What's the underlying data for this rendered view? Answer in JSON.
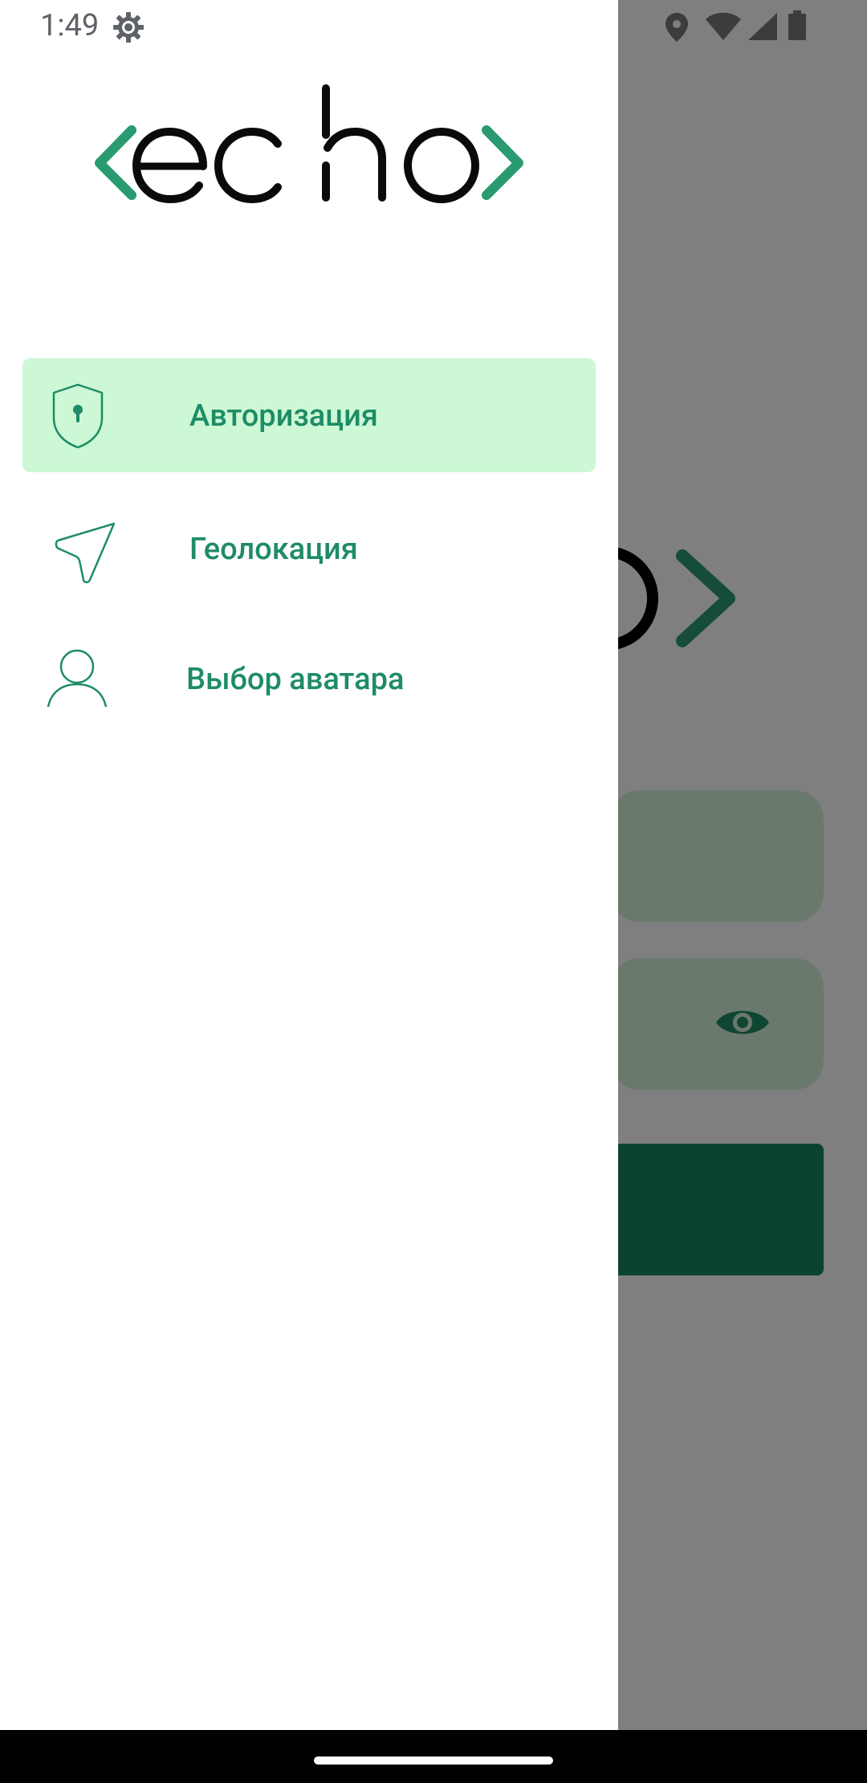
{
  "status_bar": {
    "time": "1:49",
    "icons": [
      "gear-icon",
      "location-icon",
      "wifi-icon",
      "signal-icon",
      "battery-icon"
    ]
  },
  "drawer": {
    "logo_text": "echo",
    "menu": [
      {
        "label": "Авторизация",
        "icon": "shield-lock-icon",
        "active": true
      },
      {
        "label": "Геолокация",
        "icon": "navigation-arrow-icon",
        "active": false
      },
      {
        "label": "Выбор аватара",
        "icon": "person-icon",
        "active": false
      }
    ]
  },
  "background_screen": {
    "icons": [
      "eye-icon"
    ]
  },
  "colors": {
    "accent": "#1e8c66",
    "active_item_bg": "#ccf8d5",
    "scrim": "rgba(0,0,0,0.5)",
    "button_bg": "#17865e",
    "field_bg": "#d5f3d9"
  }
}
